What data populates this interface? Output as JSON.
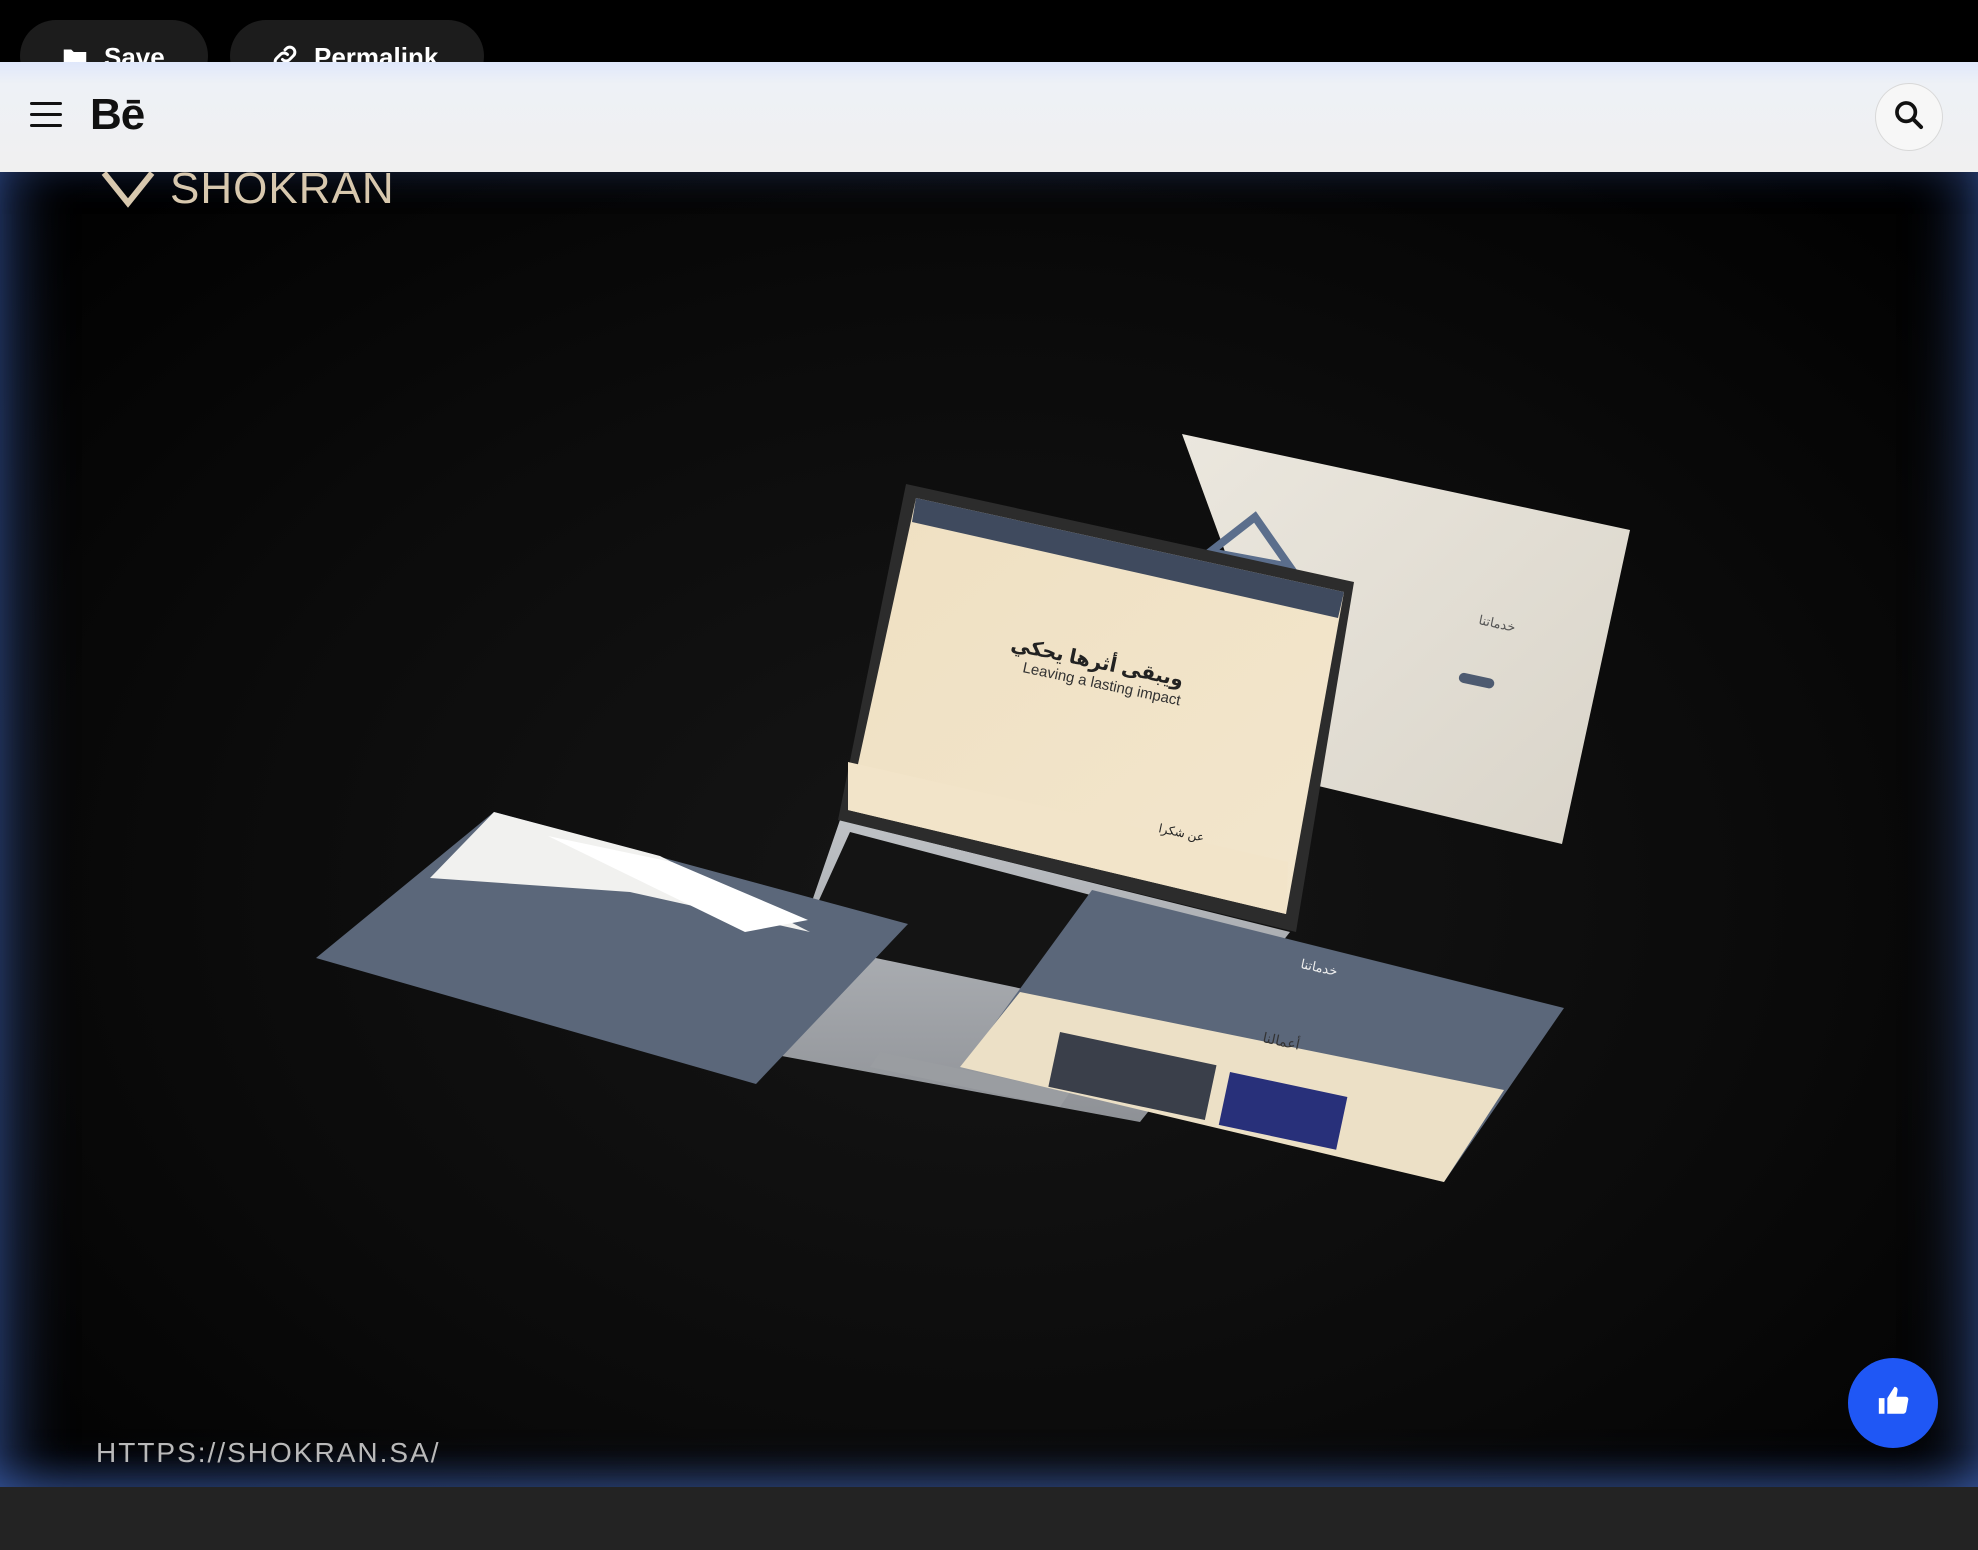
{
  "toolbar": {
    "save_label": "Save",
    "permalink_label": "Permalink"
  },
  "header": {
    "logo_text": "Bē",
    "icons": {
      "menu": "hamburger-menu-icon",
      "search": "search-icon"
    }
  },
  "project": {
    "brand_name": "SHOKRAN",
    "url_text": "HTTPS://SHOKRAN.SA/",
    "laptop_screen": {
      "arabic_heading": "ويبقى أثرها يحكي",
      "english_heading": "Leaving a lasting impact",
      "section_about": "عن شكرا"
    },
    "right_card": {
      "section_services": "خدماتنا"
    },
    "bottom_card": {
      "section_works": "أعمالنا",
      "section_services": "خدماتنا"
    }
  },
  "actions": {
    "like_icon": "thumbs-up-icon"
  },
  "colors": {
    "like_button": "#1f57f5",
    "brand_text": "#d8c8ae",
    "card_slate": "#5b677a",
    "card_cream": "#efe2c8"
  }
}
